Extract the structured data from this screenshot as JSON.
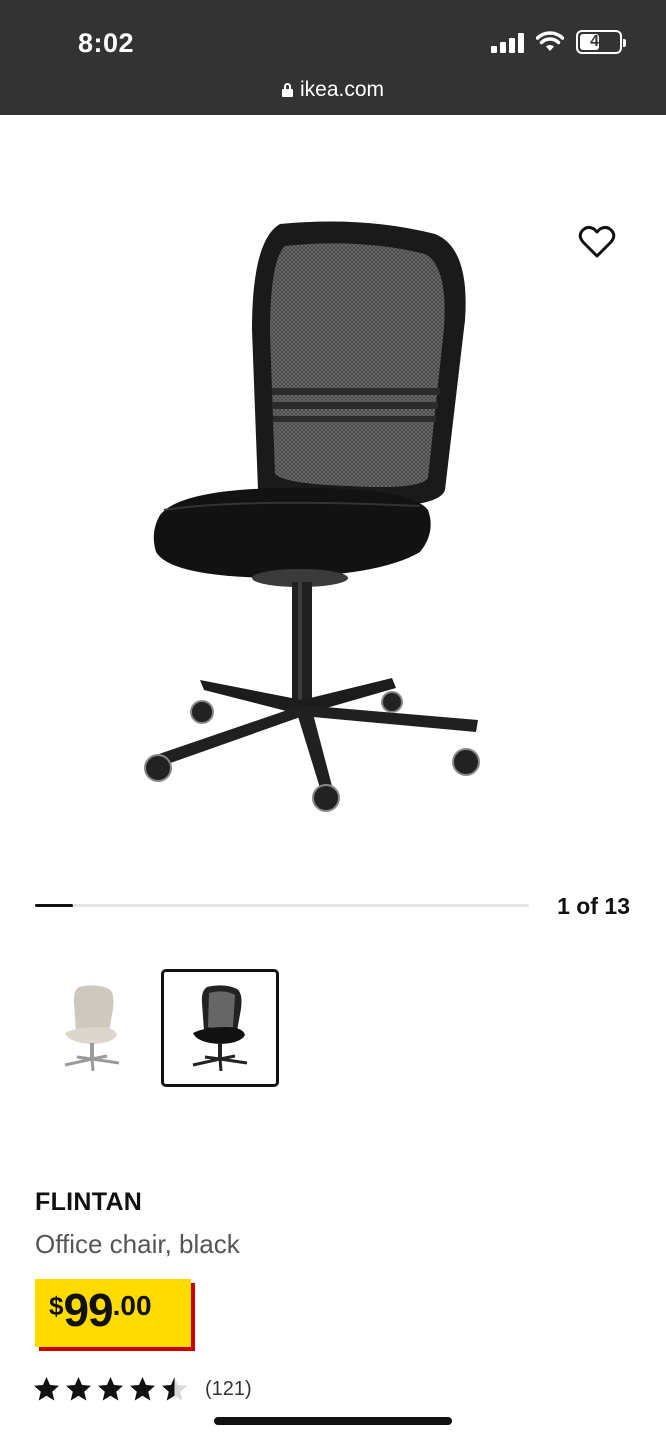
{
  "status_bar": {
    "time": "8:02",
    "battery": "47"
  },
  "browser": {
    "url": "ikea.com"
  },
  "gallery": {
    "counter": "1 of 13",
    "progress_fraction": 0.077
  },
  "product": {
    "name": "FLINTAN",
    "description": "Office chair, black",
    "price": {
      "currency": "$",
      "whole": "99",
      "decimal": ".00"
    },
    "rating": {
      "stars": 4.5,
      "max": 5,
      "review_count": "(121)"
    }
  },
  "colors": {
    "price_tag": "#ffdb00",
    "price_shadow": "#cc0008",
    "topbar": "#333333"
  },
  "icons": [
    "lock-icon",
    "wifi-icon",
    "signal-icon",
    "battery-icon",
    "heart-icon",
    "star-icon"
  ]
}
